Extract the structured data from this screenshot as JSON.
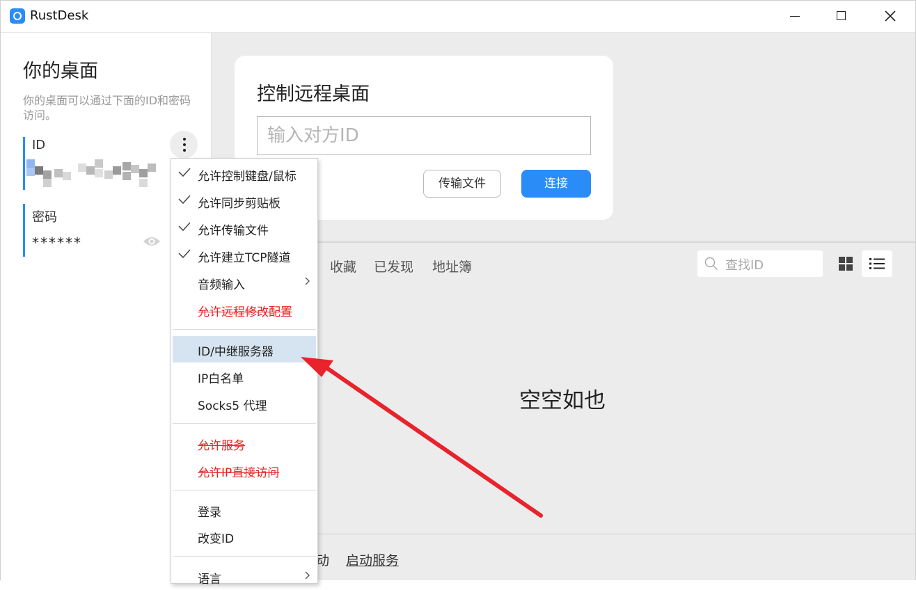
{
  "window": {
    "title": "RustDesk"
  },
  "left": {
    "title": "你的桌面",
    "description": "你的桌面可以通过下面的ID和密码访问。",
    "id_label": "ID",
    "password_label": "密码",
    "password_value": "******"
  },
  "control": {
    "title": "控制远程桌面",
    "input_placeholder": "输入对方ID",
    "transfer_button": "传输文件",
    "connect_button": "连接"
  },
  "tabs": [
    "收藏",
    "已发现",
    "地址簿"
  ],
  "search": {
    "placeholder": "查找ID"
  },
  "empty_text": "空空如也",
  "footer": {
    "status_partial": "动",
    "start_service": "启动服务"
  },
  "menu": {
    "items": [
      {
        "label": "允许控制键盘/鼠标",
        "checked": true
      },
      {
        "label": "允许同步剪贴板",
        "checked": true
      },
      {
        "label": "允许传输文件",
        "checked": true
      },
      {
        "label": "允许建立TCP隧道",
        "checked": true
      },
      {
        "label": "音频输入",
        "submenu": true
      },
      {
        "label": "允许远程修改配置",
        "disabled": true
      },
      {
        "label": "ID/中继服务器",
        "highlighted": true
      },
      {
        "label": "IP白名单"
      },
      {
        "label": "Socks5 代理"
      },
      {
        "label": "允许服务",
        "disabled": true
      },
      {
        "label": "允许IP直接访问",
        "disabled": true
      },
      {
        "label": "登录"
      },
      {
        "label": "改变ID"
      },
      {
        "label": "语言",
        "submenu": true
      }
    ]
  },
  "colors": {
    "accent": "#2a8cf7",
    "annotation": "#e8232c",
    "highlight": "#d6e4f1"
  }
}
